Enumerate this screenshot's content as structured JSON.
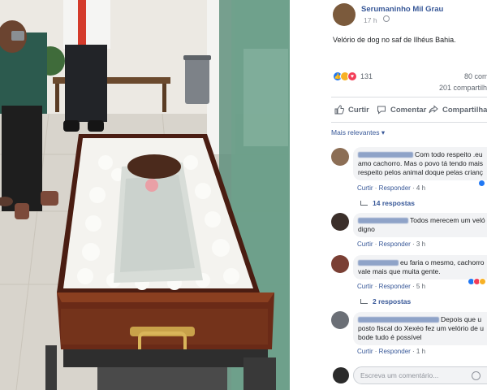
{
  "post": {
    "page_name": "Serumaninho Mil Grau",
    "time": "17 h",
    "text": "Velório de dog no saf de Ilhéus Bahia.",
    "reaction_count": "131",
    "comment_count": "80 com",
    "share_count": "201 compartilh"
  },
  "actions": {
    "like": "Curtir",
    "comment": "Comentar",
    "share": "Compartilhar"
  },
  "filter_label": "Mais relevantes ▾",
  "comments": [
    {
      "line1": "Com todo respeito .eu",
      "line2": "amo cachorro. Mas o povo tá tendo mais",
      "line3": "respeito pelos animal doque pelas crianç",
      "like": "Curtir",
      "reply": "Responder",
      "time": "4 h",
      "replies": "14 respostas"
    },
    {
      "line1": "Todos merecem um veló",
      "line2": "digno",
      "like": "Curtir",
      "reply": "Responder",
      "time": "3 h"
    },
    {
      "line1": "eu faria o mesmo, cachorro",
      "line2": "vale mais que muita gente.",
      "like": "Curtir",
      "reply": "Responder",
      "time": "5 h",
      "replies": "2 respostas"
    },
    {
      "line1": "Depois que u",
      "line2": "posto fiscal do Xexéo fez um velório de u",
      "line3": "bode tudo é possível",
      "like": "Curtir",
      "reply": "Responder",
      "time": "1 h"
    }
  ],
  "composer": {
    "placeholder": "Escreva um comentário..."
  },
  "colors": {
    "link_blue": "#385898",
    "like_blue": "#2078f4",
    "love_red": "#f33e58",
    "haha_yellow": "#f7b125",
    "bubble_gray": "#f2f3f5"
  },
  "icons": [
    "globe-icon",
    "like-icon",
    "comment-icon",
    "share-icon",
    "emoji-icon"
  ]
}
